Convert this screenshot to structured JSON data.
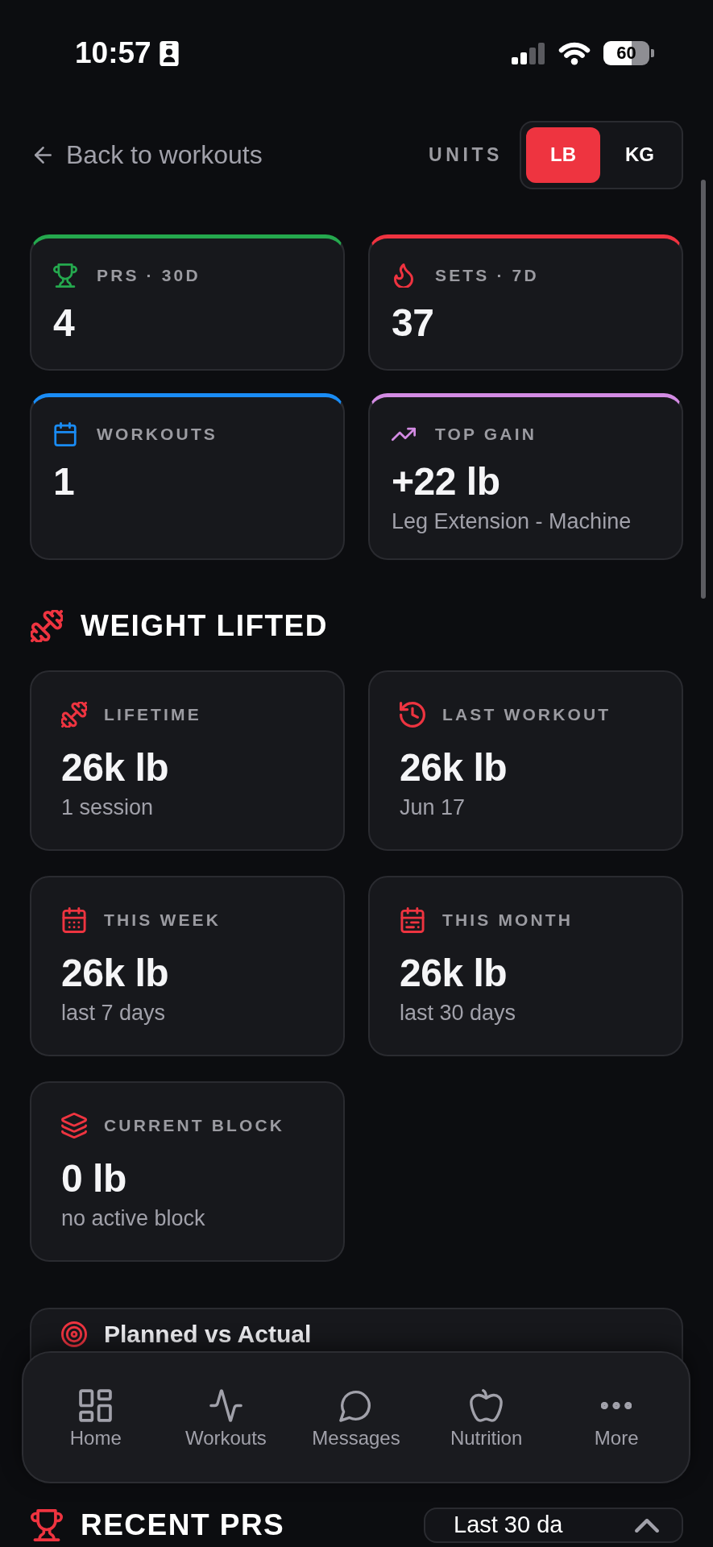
{
  "status_bar": {
    "time": "10:57",
    "battery": "60"
  },
  "header": {
    "back_link": "Back to workouts",
    "units_label": "UNITS",
    "units": [
      {
        "label": "LB",
        "selected": true
      },
      {
        "label": "KG",
        "selected": false
      }
    ]
  },
  "stat_cards": [
    {
      "label": "PRS · 30D",
      "value": "4",
      "color": "#25a84e"
    },
    {
      "label": "SETS · 7D",
      "value": "37",
      "color": "#ef3340"
    },
    {
      "label": "WORKOUTS",
      "value": "1",
      "color": "#1a8cf5"
    },
    {
      "label": "TOP GAIN",
      "value": "+22 lb",
      "subtitle": "Leg Extension - Machine",
      "color": "#d38be3"
    }
  ],
  "weight_lifted": {
    "title": "WEIGHT LIFTED",
    "cards": [
      {
        "label": "LIFETIME",
        "value": "26k lb",
        "subtitle": "1 session"
      },
      {
        "label": "LAST WORKOUT",
        "value": "26k lb",
        "subtitle": "Jun 17"
      },
      {
        "label": "THIS WEEK",
        "value": "26k lb",
        "subtitle": "last 7 days"
      },
      {
        "label": "THIS MONTH",
        "value": "26k lb",
        "subtitle": "last 30 days"
      },
      {
        "label": "CURRENT BLOCK",
        "value": "0 lb",
        "subtitle": "no active block"
      }
    ]
  },
  "planned_vs_actual": {
    "title": "Planned vs Actual"
  },
  "recent_prs": {
    "title": "RECENT PRS",
    "range": "Last 30 da"
  },
  "bottom_nav": [
    {
      "label": "Home",
      "selected": false
    },
    {
      "label": "Workouts",
      "selected": false
    },
    {
      "label": "Messages",
      "selected": false
    },
    {
      "label": "Nutrition",
      "selected": false
    },
    {
      "label": "More",
      "selected": false
    }
  ]
}
